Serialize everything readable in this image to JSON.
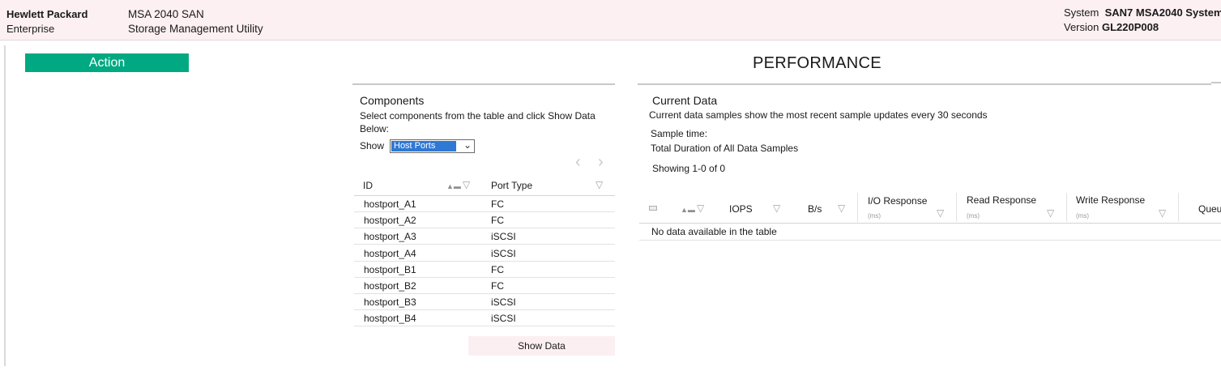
{
  "header": {
    "brand_line1": "Hewlett Packard",
    "brand_line2": "Enterprise",
    "product_line1": "MSA 2040 SAN",
    "product_line2": "Storage Management Utility",
    "system_label": "System",
    "system_value": "SAN7 MSA2040 System",
    "version_label": "Version",
    "version_value": "GL220P008"
  },
  "action_label": "Action",
  "page_title": "PERFORMANCE",
  "components": {
    "title": "Components",
    "description": "Select components from the table and click Show Data Below:",
    "show_label": "Show",
    "show_selected": "Host Ports",
    "columns": [
      "ID",
      "Port Type"
    ],
    "rows": [
      {
        "id": "hostport_A1",
        "port_type": "FC"
      },
      {
        "id": "hostport_A2",
        "port_type": "FC"
      },
      {
        "id": "hostport_A3",
        "port_type": "iSCSI"
      },
      {
        "id": "hostport_A4",
        "port_type": "iSCSI"
      },
      {
        "id": "hostport_B1",
        "port_type": "FC"
      },
      {
        "id": "hostport_B2",
        "port_type": "FC"
      },
      {
        "id": "hostport_B3",
        "port_type": "iSCSI"
      },
      {
        "id": "hostport_B4",
        "port_type": "iSCSI"
      }
    ],
    "show_data_button": "Show Data"
  },
  "current_data": {
    "title": "Current Data",
    "description": "Current data samples show the most recent sample updates every 30 seconds",
    "sample_time_label": "Sample time:",
    "total_duration_label": "Total Duration of All Data  Samples",
    "showing": "Showing 1-0 of 0",
    "columns": {
      "iops": "IOPS",
      "bps": "B/s",
      "io_response": "I/O Response",
      "read_response": "Read Response",
      "write_response": "Write Response",
      "queue": "Queu",
      "unit": "(ms)"
    },
    "empty_message": "No data available in the table"
  },
  "icons": {
    "filter": "filter-icon",
    "sort": "sort-icon",
    "prev": "chevron-left-icon",
    "next": "chevron-right-icon",
    "dropdown": "chevron-down-icon"
  },
  "colors": {
    "header_bg": "#fdf0f3",
    "action_green": "#01a982",
    "select_blue": "#2f78d4"
  }
}
